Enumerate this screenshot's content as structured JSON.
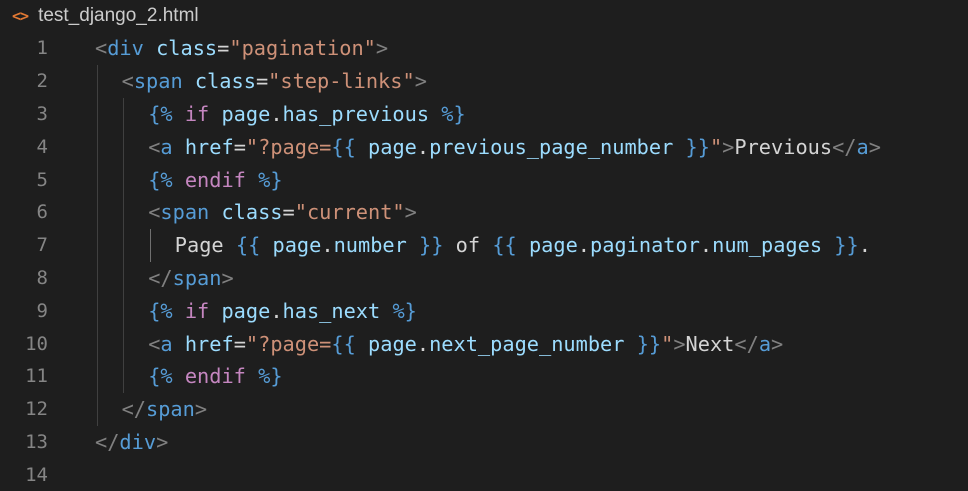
{
  "tab": {
    "icon": "html-file-icon",
    "icon_glyph": "<>",
    "filename": "test_django_2.html"
  },
  "colors": {
    "background": "#1e1e1e",
    "line_number": "#858585",
    "tag": "#569cd6",
    "attribute": "#9cdcfe",
    "string": "#ce9178",
    "keyword": "#c586c0",
    "text": "#d4d4d4",
    "bracket": "#808080"
  },
  "lines": [
    {
      "n": "1",
      "indent": 0,
      "tokens": [
        [
          "tk-bracket",
          "<"
        ],
        [
          "tk-tag",
          "div"
        ],
        [
          "tk-text",
          " "
        ],
        [
          "tk-attr",
          "class"
        ],
        [
          "tk-text",
          "="
        ],
        [
          "tk-str",
          "\"pagination\""
        ],
        [
          "tk-bracket",
          ">"
        ]
      ]
    },
    {
      "n": "2",
      "indent": 1,
      "tokens": [
        [
          "tk-bracket",
          "<"
        ],
        [
          "tk-tag",
          "span"
        ],
        [
          "tk-text",
          " "
        ],
        [
          "tk-attr",
          "class"
        ],
        [
          "tk-text",
          "="
        ],
        [
          "tk-str",
          "\"step-links\""
        ],
        [
          "tk-bracket",
          ">"
        ]
      ]
    },
    {
      "n": "3",
      "indent": 2,
      "tokens": [
        [
          "tk-tpl",
          "{%"
        ],
        [
          "tk-text",
          " "
        ],
        [
          "tk-kw",
          "if"
        ],
        [
          "tk-text",
          " "
        ],
        [
          "tk-var",
          "page"
        ],
        [
          "tk-dot",
          "."
        ],
        [
          "tk-var",
          "has_previous"
        ],
        [
          "tk-text",
          " "
        ],
        [
          "tk-tpl",
          "%}"
        ]
      ]
    },
    {
      "n": "4",
      "indent": 2,
      "tokens": [
        [
          "tk-bracket",
          "<"
        ],
        [
          "tk-tag",
          "a"
        ],
        [
          "tk-text",
          " "
        ],
        [
          "tk-attr",
          "href"
        ],
        [
          "tk-text",
          "="
        ],
        [
          "tk-str",
          "\"?page="
        ],
        [
          "tk-tpl",
          "{{"
        ],
        [
          "tk-text",
          " "
        ],
        [
          "tk-var",
          "page"
        ],
        [
          "tk-dot",
          "."
        ],
        [
          "tk-var",
          "previous_page_number"
        ],
        [
          "tk-text",
          " "
        ],
        [
          "tk-tpl",
          "}}"
        ],
        [
          "tk-str",
          "\""
        ],
        [
          "tk-bracket",
          ">"
        ],
        [
          "tk-text",
          "Previous"
        ],
        [
          "tk-bracket",
          "</"
        ],
        [
          "tk-tag",
          "a"
        ],
        [
          "tk-bracket",
          ">"
        ]
      ]
    },
    {
      "n": "5",
      "indent": 2,
      "tokens": [
        [
          "tk-tpl",
          "{%"
        ],
        [
          "tk-text",
          " "
        ],
        [
          "tk-kw",
          "endif"
        ],
        [
          "tk-text",
          " "
        ],
        [
          "tk-tpl",
          "%}"
        ]
      ]
    },
    {
      "n": "6",
      "indent": 2,
      "tokens": [
        [
          "tk-bracket",
          "<"
        ],
        [
          "tk-tag",
          "span"
        ],
        [
          "tk-text",
          " "
        ],
        [
          "tk-attr",
          "class"
        ],
        [
          "tk-text",
          "="
        ],
        [
          "tk-str",
          "\"current\""
        ],
        [
          "tk-bracket",
          ">"
        ]
      ]
    },
    {
      "n": "7",
      "indent": 3,
      "tokens": [
        [
          "tk-text",
          "Page "
        ],
        [
          "tk-tpl",
          "{{"
        ],
        [
          "tk-text",
          " "
        ],
        [
          "tk-var",
          "page"
        ],
        [
          "tk-dot",
          "."
        ],
        [
          "tk-var",
          "number"
        ],
        [
          "tk-text",
          " "
        ],
        [
          "tk-tpl",
          "}}"
        ],
        [
          "tk-text",
          " of "
        ],
        [
          "tk-tpl",
          "{{"
        ],
        [
          "tk-text",
          " "
        ],
        [
          "tk-var",
          "page"
        ],
        [
          "tk-dot",
          "."
        ],
        [
          "tk-var",
          "paginator"
        ],
        [
          "tk-dot",
          "."
        ],
        [
          "tk-var",
          "num_pages"
        ],
        [
          "tk-text",
          " "
        ],
        [
          "tk-tpl",
          "}}"
        ],
        [
          "tk-text",
          "."
        ]
      ]
    },
    {
      "n": "8",
      "indent": 2,
      "tokens": [
        [
          "tk-bracket",
          "</"
        ],
        [
          "tk-tag",
          "span"
        ],
        [
          "tk-bracket",
          ">"
        ]
      ]
    },
    {
      "n": "9",
      "indent": 2,
      "tokens": [
        [
          "tk-tpl",
          "{%"
        ],
        [
          "tk-text",
          " "
        ],
        [
          "tk-kw",
          "if"
        ],
        [
          "tk-text",
          " "
        ],
        [
          "tk-var",
          "page"
        ],
        [
          "tk-dot",
          "."
        ],
        [
          "tk-var",
          "has_next"
        ],
        [
          "tk-text",
          " "
        ],
        [
          "tk-tpl",
          "%}"
        ]
      ]
    },
    {
      "n": "10",
      "indent": 2,
      "tokens": [
        [
          "tk-bracket",
          "<"
        ],
        [
          "tk-tag",
          "a"
        ],
        [
          "tk-text",
          " "
        ],
        [
          "tk-attr",
          "href"
        ],
        [
          "tk-text",
          "="
        ],
        [
          "tk-str",
          "\"?page="
        ],
        [
          "tk-tpl",
          "{{"
        ],
        [
          "tk-text",
          " "
        ],
        [
          "tk-var",
          "page"
        ],
        [
          "tk-dot",
          "."
        ],
        [
          "tk-var",
          "next_page_number"
        ],
        [
          "tk-text",
          " "
        ],
        [
          "tk-tpl",
          "}}"
        ],
        [
          "tk-str",
          "\""
        ],
        [
          "tk-bracket",
          ">"
        ],
        [
          "tk-text",
          "Next"
        ],
        [
          "tk-bracket",
          "</"
        ],
        [
          "tk-tag",
          "a"
        ],
        [
          "tk-bracket",
          ">"
        ]
      ]
    },
    {
      "n": "11",
      "indent": 2,
      "tokens": [
        [
          "tk-tpl",
          "{%"
        ],
        [
          "tk-text",
          " "
        ],
        [
          "tk-kw",
          "endif"
        ],
        [
          "tk-text",
          " "
        ],
        [
          "tk-tpl",
          "%}"
        ]
      ]
    },
    {
      "n": "12",
      "indent": 1,
      "tokens": [
        [
          "tk-bracket",
          "</"
        ],
        [
          "tk-tag",
          "span"
        ],
        [
          "tk-bracket",
          ">"
        ]
      ]
    },
    {
      "n": "13",
      "indent": 0,
      "tokens": [
        [
          "tk-bracket",
          "</"
        ],
        [
          "tk-tag",
          "div"
        ],
        [
          "tk-bracket",
          ">"
        ]
      ]
    },
    {
      "n": "14",
      "indent": 0,
      "tokens": []
    }
  ]
}
